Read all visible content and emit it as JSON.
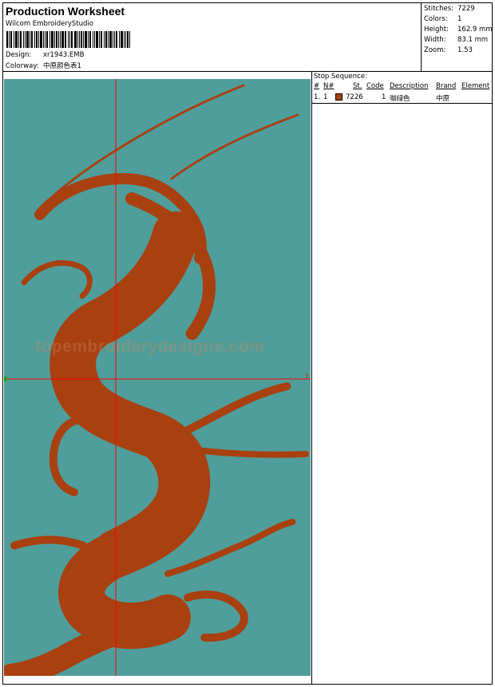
{
  "header": {
    "title": "Production Worksheet",
    "software": "Wilcom EmbroideryStudio",
    "design_label": "Design:",
    "design_value": "xr1943.EMB",
    "colorway_label": "Colorway:",
    "colorway_value": "中原颜色表1"
  },
  "stats": {
    "stitches_label": "Stitches:",
    "stitches_value": "7229",
    "colors_label": "Colors:",
    "colors_value": "1",
    "height_label": "Height:",
    "height_value": "162.9 mm",
    "width_label": "Width:",
    "width_value": "83.1 mm",
    "zoom_label": "Zoom:",
    "zoom_value": "1.53"
  },
  "canvas": {
    "background_color": "#4f9e9b",
    "thread_color": "#a84010",
    "crosshair_color": "#ff0000",
    "axis_marker": "2",
    "watermark": "topembroiderydesigns.com"
  },
  "stop_sequence": {
    "title": "Stop Sequence:",
    "headers": {
      "num": "#",
      "needle": "N#",
      "stitches": "St.",
      "code": "Code",
      "description": "Description",
      "brand": "Brand",
      "element": "Element"
    },
    "rows": [
      {
        "num": "1.",
        "needle": "1",
        "swatch_color": "#a84010",
        "code": "7226",
        "stitches": "1",
        "description": "咖绿色",
        "brand": "中原",
        "element": ""
      }
    ]
  }
}
